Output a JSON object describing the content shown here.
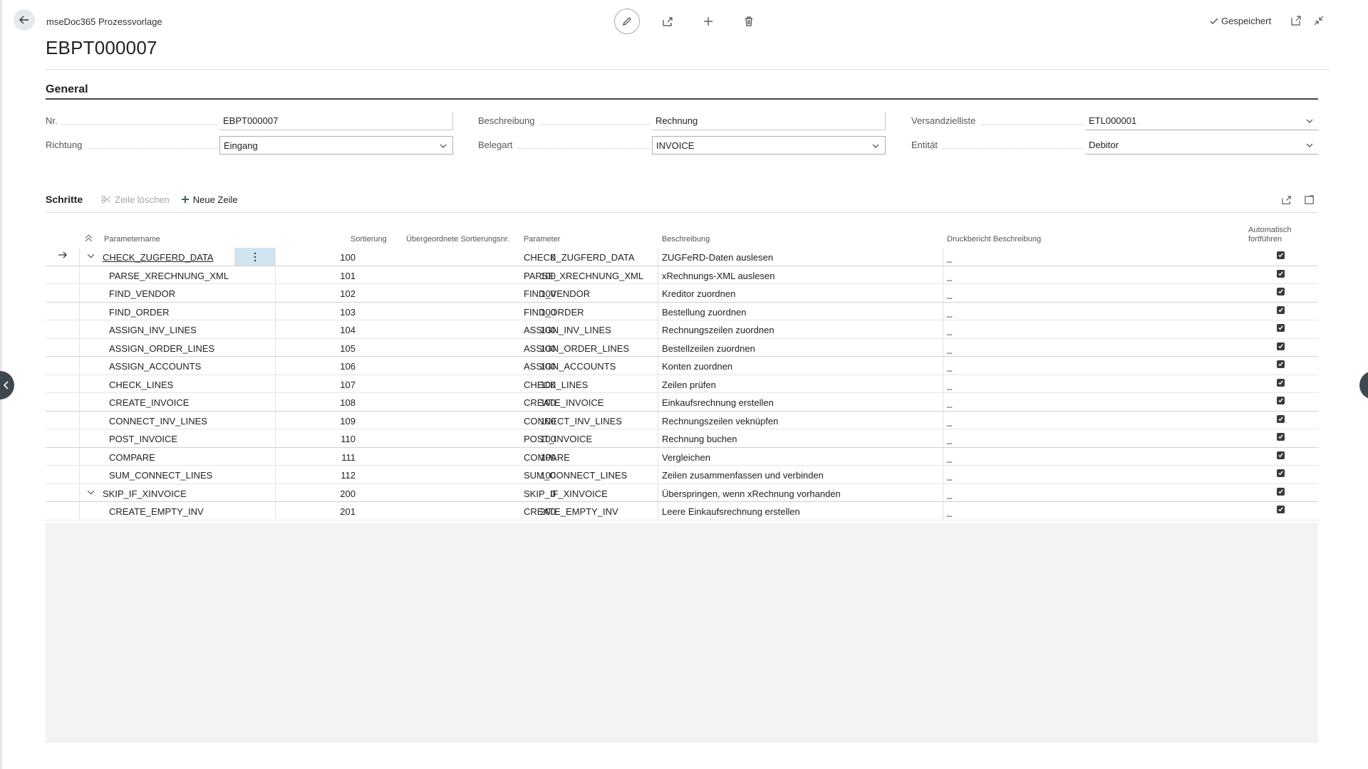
{
  "header": {
    "caption": "mseDoc365 Prozessvorlage",
    "title": "EBPT000007",
    "status": "Gespeichert"
  },
  "general": {
    "section_title": "General",
    "fields": {
      "nr": {
        "label": "Nr.",
        "value": "EBPT000007"
      },
      "beschreibung": {
        "label": "Beschreibung",
        "value": "Rechnung"
      },
      "versandzielliste": {
        "label": "Versandzielliste",
        "value": "ETL000001"
      },
      "richtung": {
        "label": "Richtung",
        "value": "Eingang"
      },
      "belegart": {
        "label": "Belegart",
        "value": "INVOICE"
      },
      "entitaet": {
        "label": "Entität",
        "value": "Debitor"
      }
    }
  },
  "steps": {
    "title": "Schritte",
    "delete_label": "Zeile löschen",
    "new_label": "Neue Zeile",
    "columns": {
      "parametername": "Parametername",
      "sortierung": "Sortierung",
      "parent_sort": "Übergeordnete Sortierungsnr.",
      "parameter": "Parameter",
      "beschreibung": "Beschreibung",
      "druckbericht": "Druckbericht Beschreibung",
      "auto_line1": "Automatisch",
      "auto_line2": "fortführen"
    },
    "empty_value": "_",
    "rows": [
      {
        "name": "CHECK_ZUGFERD_DATA",
        "sort": "100",
        "parent": "0",
        "param": "CHECK_ZUGFERD_DATA",
        "desc": "ZUGFeRD-Daten auslesen"
      },
      {
        "name": "PARSE_XRECHNUNG_XML",
        "sort": "101",
        "parent": "100",
        "param": "PARSE_XRECHNUNG_XML",
        "desc": "xRechnungs-XML auslesen"
      },
      {
        "name": "FIND_VENDOR",
        "sort": "102",
        "parent": "100",
        "param": "FIND_VENDOR",
        "desc": "Kreditor zuordnen"
      },
      {
        "name": "FIND_ORDER",
        "sort": "103",
        "parent": "100",
        "param": "FIND_ORDER",
        "desc": "Bestellung zuordnen"
      },
      {
        "name": "ASSIGN_INV_LINES",
        "sort": "104",
        "parent": "100",
        "param": "ASSIGN_INV_LINES",
        "desc": "Rechnungszeilen zuordnen"
      },
      {
        "name": "ASSIGN_ORDER_LINES",
        "sort": "105",
        "parent": "100",
        "param": "ASSIGN_ORDER_LINES",
        "desc": "Bestellzeilen zuordnen"
      },
      {
        "name": "ASSIGN_ACCOUNTS",
        "sort": "106",
        "parent": "100",
        "param": "ASSIGN_ACCOUNTS",
        "desc": "Konten zuordnen"
      },
      {
        "name": "CHECK_LINES",
        "sort": "107",
        "parent": "100",
        "param": "CHECK_LINES",
        "desc": "Zeilen prüfen"
      },
      {
        "name": "CREATE_INVOICE",
        "sort": "108",
        "parent": "100",
        "param": "CREATE_INVOICE",
        "desc": "Einkaufsrechnung erstellen"
      },
      {
        "name": "CONNECT_INV_LINES",
        "sort": "109",
        "parent": "100",
        "param": "CONNECT_INV_LINES",
        "desc": "Rechnungszeilen veknüpfen"
      },
      {
        "name": "POST_INVOICE",
        "sort": "110",
        "parent": "100",
        "param": "POST_INVOICE",
        "desc": "Rechnung buchen"
      },
      {
        "name": "COMPARE",
        "sort": "111",
        "parent": "100",
        "param": "COMPARE",
        "desc": "Vergleichen"
      },
      {
        "name": "SUM_CONNECT_LINES",
        "sort": "112",
        "parent": "100",
        "param": "SUM_CONNECT_LINES",
        "desc": "Zeilen zusammenfassen und verbinden"
      },
      {
        "name": "SKIP_IF_XINVOICE",
        "sort": "200",
        "parent": "0",
        "param": "SKIP_IF_XINVOICE",
        "desc": "Überspringen, wenn xRechnung vorhanden"
      },
      {
        "name": "CREATE_EMPTY_INV",
        "sort": "201",
        "parent": "200",
        "param": "CREATE_EMPTY_INV",
        "desc": "Leere Einkaufsrechnung erstellen"
      }
    ]
  }
}
